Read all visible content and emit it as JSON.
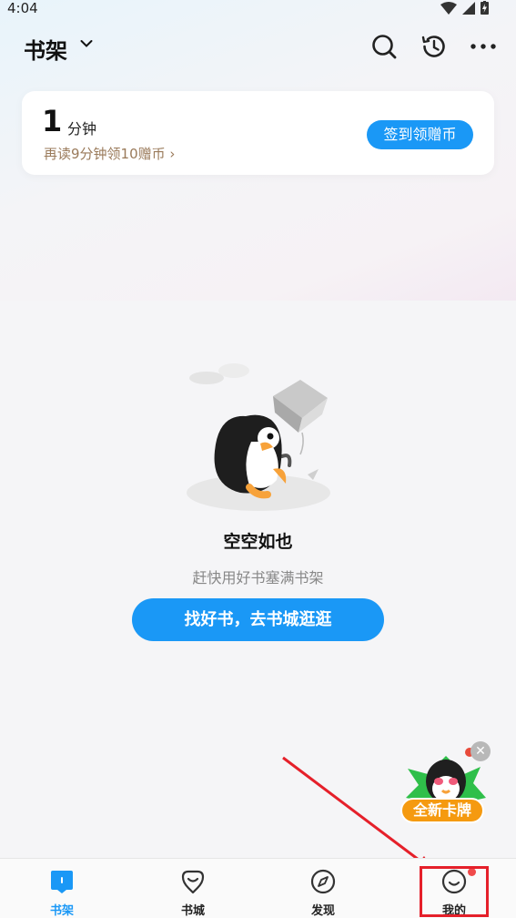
{
  "status_bar": {
    "time": "4:04"
  },
  "header": {
    "title": "书架"
  },
  "reading_card": {
    "minutes": "1",
    "unit": "分钟",
    "hint": "再读9分钟领10赠币 ›",
    "signin_label": "签到领赠币"
  },
  "empty_state": {
    "title": "空空如也",
    "subtitle": "赶快用好书塞满书架",
    "button_label": "找好书，去书城逛逛"
  },
  "promo": {
    "label": "全新卡牌"
  },
  "bottom_nav": [
    {
      "label": "书架",
      "icon": "bookshelf-icon",
      "active": true
    },
    {
      "label": "书城",
      "icon": "bookstore-icon",
      "active": false
    },
    {
      "label": "发现",
      "icon": "compass-icon",
      "active": false
    },
    {
      "label": "我的",
      "icon": "smiley-icon",
      "active": false,
      "badge": true
    }
  ],
  "colors": {
    "accent": "#1a98f6",
    "annotation": "#e5202a",
    "badge": "#f04a4a"
  }
}
